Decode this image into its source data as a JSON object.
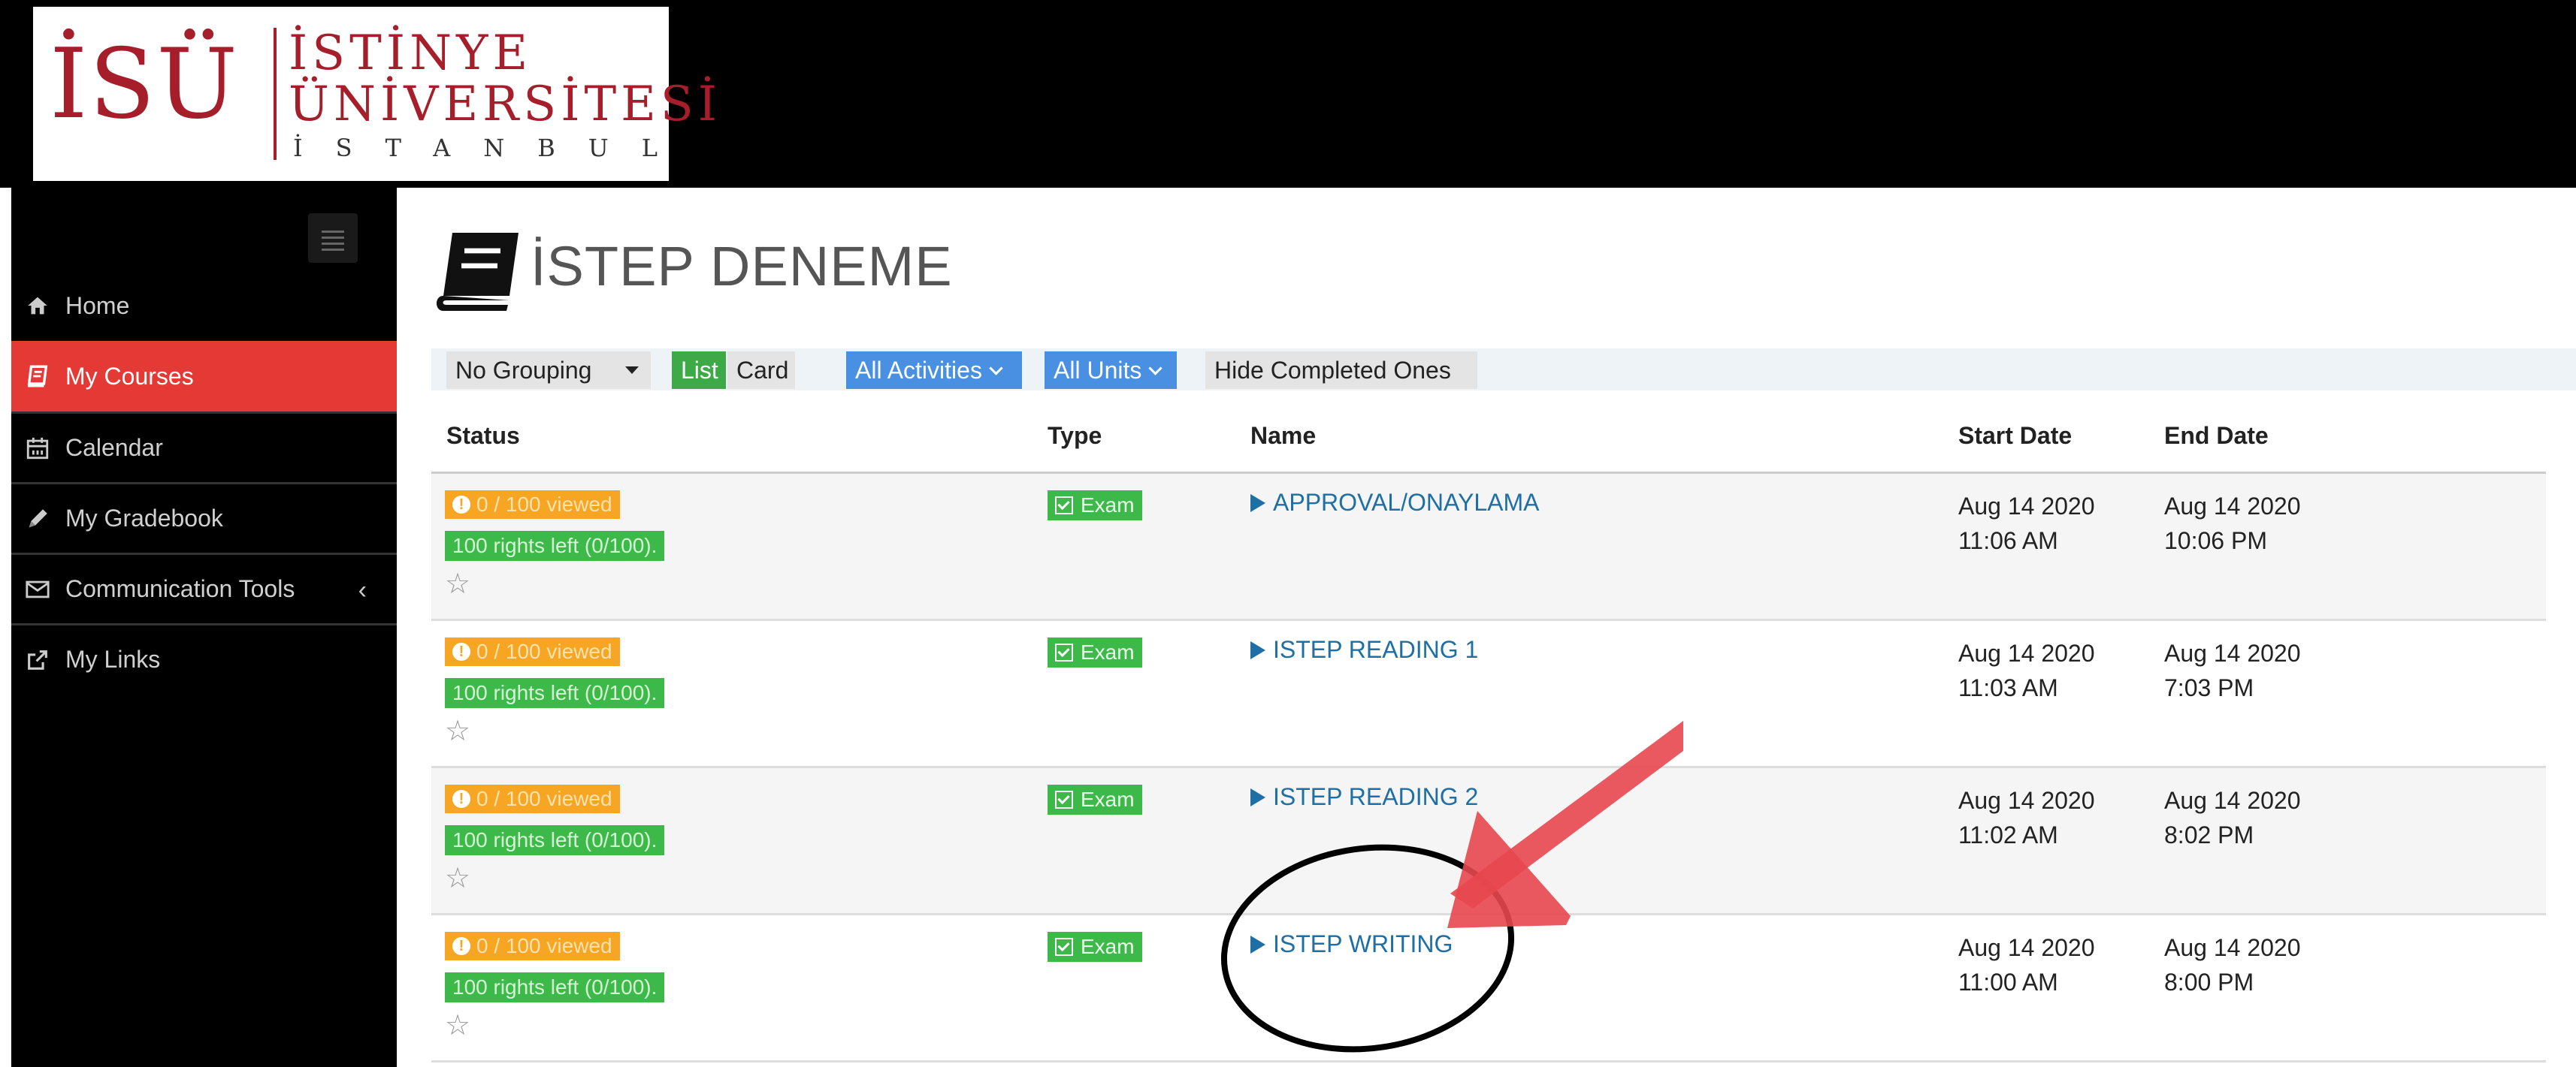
{
  "logo": {
    "abbr": "İSÜ",
    "line1": "İSTİNYE",
    "line2": "ÜNİVERSİTESİ",
    "city": "İSTANBUL",
    "brand_color": "#a51e2a"
  },
  "sidebar": {
    "menu_icon": "hamburger-icon",
    "items": [
      {
        "label": "Home",
        "icon": "home-icon",
        "active": false
      },
      {
        "label": "My Courses",
        "icon": "book-icon",
        "active": true
      },
      {
        "label": "Calendar",
        "icon": "calendar-icon",
        "active": false
      },
      {
        "label": "My Gradebook",
        "icon": "pencil-icon",
        "active": false
      },
      {
        "label": "Communication Tools",
        "icon": "envelope-icon",
        "active": false,
        "has_submenu": true
      },
      {
        "label": "My Links",
        "icon": "external-link-icon",
        "active": false
      }
    ],
    "active_color": "#e53935"
  },
  "page": {
    "title": "İSTEP DENEME",
    "icon": "book-icon"
  },
  "toolbar": {
    "grouping": "No Grouping",
    "view_list": "List",
    "view_card": "Card",
    "activities": "All Activities",
    "units": "All Units",
    "hide_completed": "Hide Completed Ones"
  },
  "table": {
    "headers": {
      "status": "Status",
      "type": "Type",
      "name": "Name",
      "start": "Start Date",
      "end": "End Date"
    },
    "rows": [
      {
        "viewed": "0 / 100 viewed",
        "rights": "100 rights left (0/100).",
        "type": "Exam",
        "name": "APPROVAL/ONAYLAMA",
        "start_date": "Aug 14 2020",
        "start_time": "11:06 AM",
        "end_date": "Aug 14 2020",
        "end_time": "10:06 PM"
      },
      {
        "viewed": "0 / 100 viewed",
        "rights": "100 rights left (0/100).",
        "type": "Exam",
        "name": "ISTEP READING 1",
        "start_date": "Aug 14 2020",
        "start_time": "11:03 AM",
        "end_date": "Aug 14 2020",
        "end_time": "7:03 PM"
      },
      {
        "viewed": "0 / 100 viewed",
        "rights": "100 rights left (0/100).",
        "type": "Exam",
        "name": "ISTEP READING 2",
        "start_date": "Aug 14 2020",
        "start_time": "11:02 AM",
        "end_date": "Aug 14 2020",
        "end_time": "8:02 PM"
      },
      {
        "viewed": "0 / 100 viewed",
        "rights": "100 rights left (0/100).",
        "type": "Exam",
        "name": "ISTEP WRITING",
        "start_date": "Aug 14 2020",
        "start_time": "11:00 AM",
        "end_date": "Aug 14 2020",
        "end_time": "8:00 PM"
      }
    ]
  },
  "annotation": {
    "circle_target": "ISTEP WRITING",
    "arrow_color": "#e8474f",
    "circle_color": "#000000"
  }
}
